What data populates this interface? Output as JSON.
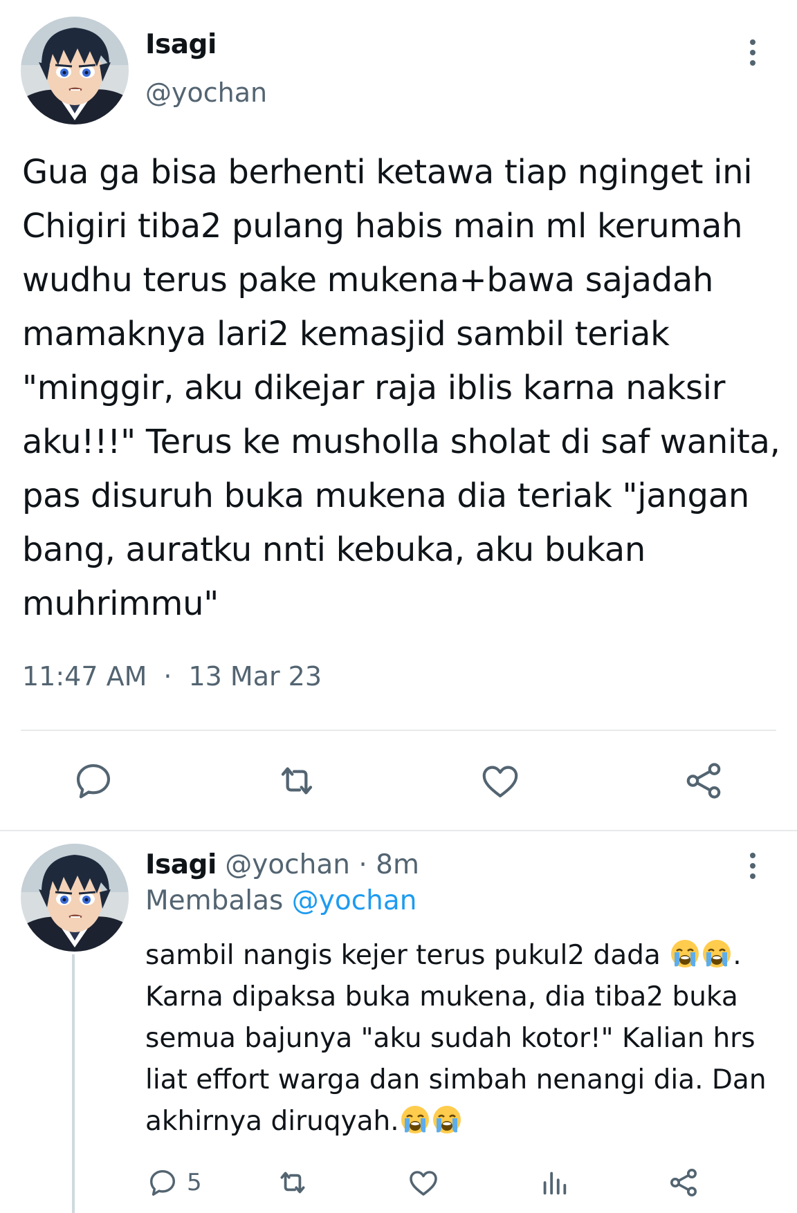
{
  "main_tweet": {
    "name": "Isagi",
    "handle": "@yochan",
    "text": "Gua ga bisa berhenti ketawa tiap nginget ini\nChigiri tiba2 pulang habis main ml kerumah\nwudhu terus pake mukena+bawa sajadah\nmamaknya lari2 kemasjid sambil teriak\n\"minggir, aku dikejar raja iblis karna naksir\naku!!!\" Terus ke musholla sholat di saf wanita,\npas disuruh buka mukena dia teriak \"jangan\nbang, auratku nnti kebuka, aku bukan\nmuhrimmu\"",
    "time": "11:47 AM",
    "separator": "·",
    "date": "13 Mar 23",
    "actions": [
      "reply-icon",
      "retweet-icon",
      "like-icon",
      "share-icon"
    ]
  },
  "reply": {
    "name": "Isagi",
    "handle": "@yochan",
    "dot": "·",
    "age": "8m",
    "replying_label": "Membalas",
    "replying_to": "@yochan",
    "text_part1": "sambil nangis kejer terus pukul2 dada ",
    "text_part2": ".\nKarna dipaksa buka mukena, dia tiba2 buka\nsemua bajunya \"aku sudah kotor!\" Kalian hrs\nliat effort warga dan simbah nenangi dia. Dan\nakhirnya diruqyah.",
    "emoji": "loudly-crying-face",
    "reply_count": "5",
    "actions": [
      "reply-icon",
      "retweet-icon",
      "like-icon",
      "analytics-icon",
      "share-icon"
    ]
  },
  "colors": {
    "text_primary": "#0f1419",
    "text_secondary": "#536471",
    "link": "#1d9bf0",
    "divider": "#e7e9ea"
  }
}
